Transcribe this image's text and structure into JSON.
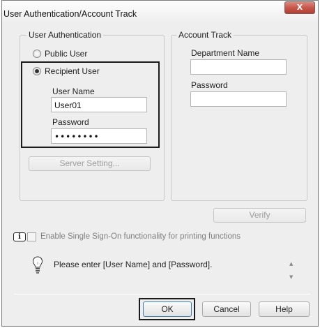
{
  "window": {
    "title": "User Authentication/Account Track",
    "close_glyph": "X"
  },
  "user_auth": {
    "legend": "User Authentication",
    "public_user_label": "Public User",
    "public_user_selected": false,
    "recipient_user_label": "Recipient User",
    "recipient_user_selected": true,
    "user_name_label": "User Name",
    "user_name_value": "User01",
    "password_label": "Password",
    "password_value": "••••••••",
    "server_setting_label": "Server Setting..."
  },
  "account_track": {
    "legend": "Account Track",
    "department_name_label": "Department Name",
    "department_name_value": "",
    "password_label": "Password",
    "password_value": ""
  },
  "verify_label": "Verify",
  "sso": {
    "info_glyph": "i",
    "checked": false,
    "label": "Enable Single Sign-On functionality for printing functions"
  },
  "message": {
    "icon": "lightbulb-icon",
    "text": "Please enter [User Name] and [Password]."
  },
  "buttons": {
    "ok": "OK",
    "cancel": "Cancel",
    "help": "Help"
  }
}
